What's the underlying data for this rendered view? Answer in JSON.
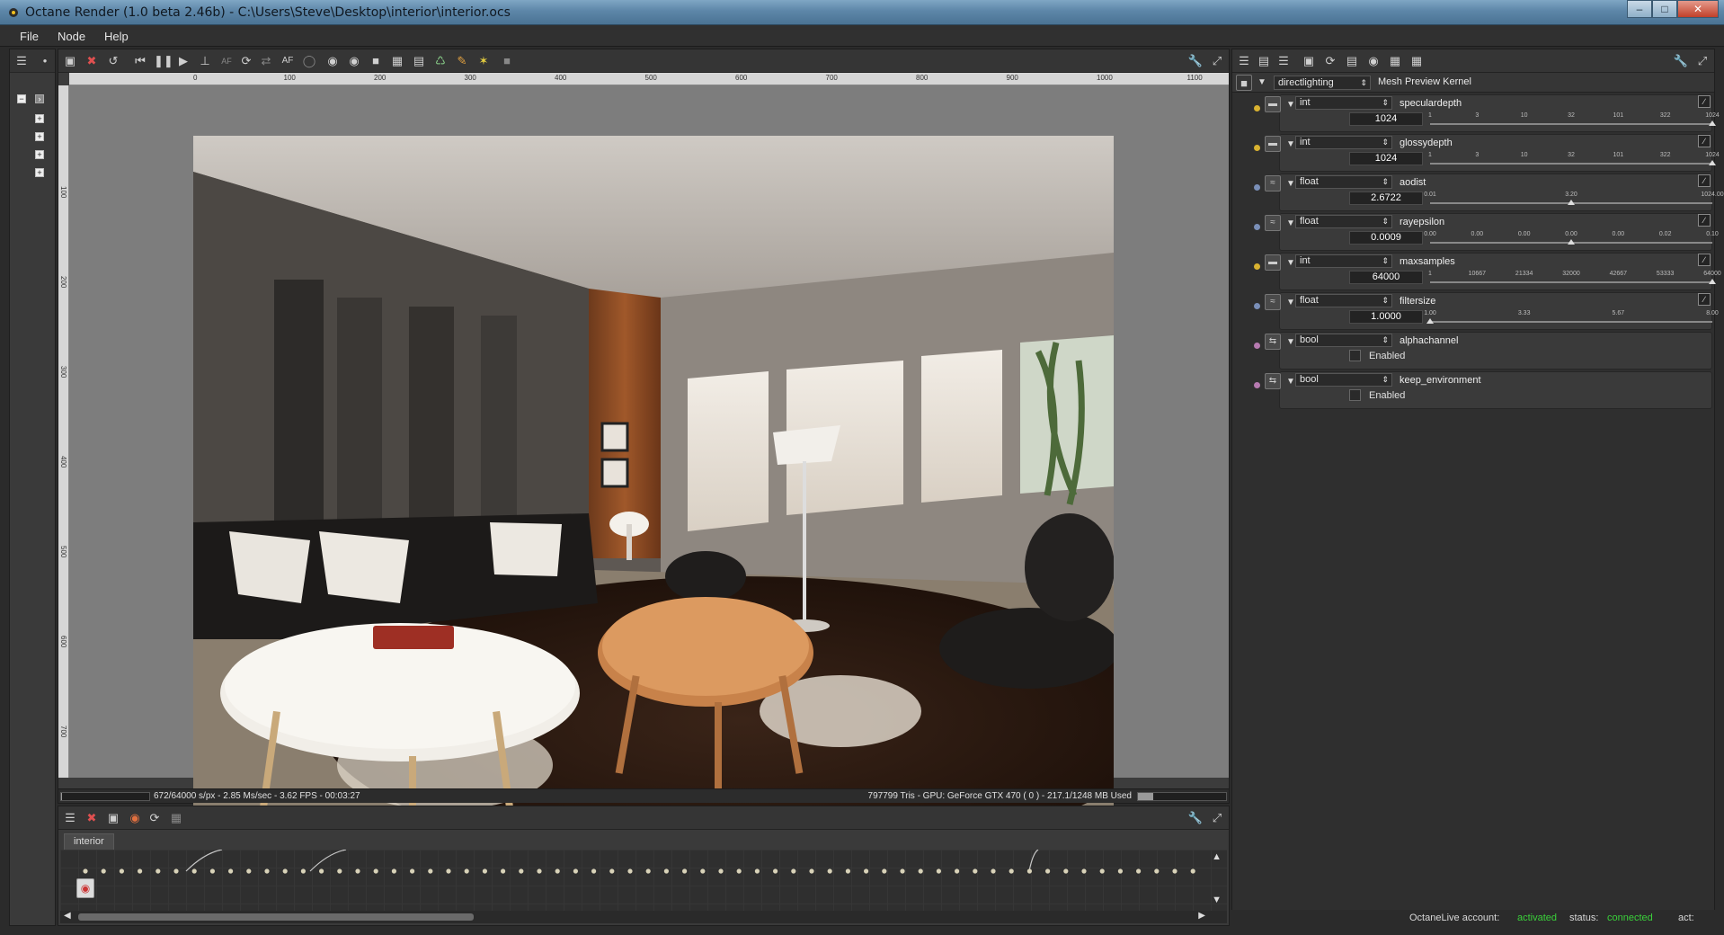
{
  "window": {
    "title": "Octane Render (1.0 beta 2.46b) - C:\\Users\\Steve\\Desktop\\interior\\interior.ocs",
    "minimize": "–",
    "maximize": "□",
    "close": "✕"
  },
  "menu": [
    "File",
    "Node",
    "Help"
  ],
  "viewport": {
    "ruler_ticks": [
      "0",
      "100",
      "200",
      "300",
      "400",
      "500",
      "600",
      "700",
      "800",
      "900",
      "1000",
      "1100"
    ],
    "vruler_ticks": [
      "100",
      "200",
      "300",
      "400",
      "500",
      "600",
      "700"
    ],
    "status_left": "672/64000 s/px - 2.85 Ms/sec - 3.62 FPS - 00:03:27",
    "status_right": "797799 Tris - GPU: GeForce GTX 470 ( 0 ) - 217.1/1248 MB Used",
    "progress": 0.0105,
    "gpu_memory_fraction": 0.174
  },
  "graph": {
    "tab": "interior"
  },
  "inspector": {
    "kernel_type": "directlighting",
    "kernel_name": "Mesh Preview Kernel",
    "pins": [
      {
        "type": "int",
        "name": "speculardepth",
        "value": "1024",
        "dot": "#d9b230",
        "ticks": [
          "1",
          "3",
          "10",
          "32",
          "101",
          "322",
          "1024"
        ],
        "pos": 1.0
      },
      {
        "type": "int",
        "name": "glossydepth",
        "value": "1024",
        "dot": "#d9b230",
        "ticks": [
          "1",
          "3",
          "10",
          "32",
          "101",
          "322",
          "1024"
        ],
        "pos": 1.0
      },
      {
        "type": "float",
        "name": "aodist",
        "value": "2.6722",
        "dot": "#7a8fb8",
        "ticks": [
          "0.01",
          "",
          "",
          "3.20",
          "",
          "",
          "1024.00"
        ],
        "pos": 0.5
      },
      {
        "type": "float",
        "name": "rayepsilon",
        "value": "0.0009",
        "dot": "#7a8fb8",
        "ticks": [
          "0.00",
          "0.00",
          "0.00",
          "0.00",
          "0.00",
          "0.02",
          "0.10"
        ],
        "pos": 0.5
      },
      {
        "type": "int",
        "name": "maxsamples",
        "value": "64000",
        "dot": "#d9b230",
        "ticks": [
          "1",
          "10667",
          "21334",
          "32000",
          "42667",
          "53333",
          "64000"
        ],
        "pos": 1.0
      },
      {
        "type": "float",
        "name": "filtersize",
        "value": "1.0000",
        "dot": "#7a8fb8",
        "ticks": [
          "1.00",
          "",
          "3.33",
          "",
          "5.67",
          "",
          "8.00"
        ],
        "pos": 0.0
      },
      {
        "type": "bool",
        "name": "alphachannel",
        "checkbox": "Enabled",
        "dot": "#b67ab0"
      },
      {
        "type": "bool",
        "name": "keep_environment",
        "checkbox": "Enabled",
        "dot": "#b67ab0"
      }
    ]
  },
  "footer": {
    "account_label": "OctaneLive account:",
    "account_value": "activated",
    "status_label": "status:",
    "status_value": "connected",
    "act_label": "act:"
  },
  "icons": [
    "app-icon",
    "outline-icon",
    "settings-wrench-icon",
    "fullscreen-icon",
    "play-icon",
    "pause-icon",
    "rewind-icon"
  ]
}
